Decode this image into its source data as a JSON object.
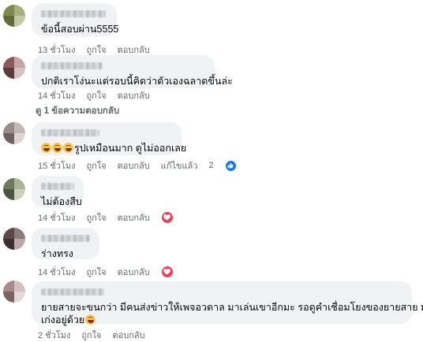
{
  "comments": [
    {
      "text": "ข้อนี้สอบผ่าน5555",
      "time": "13 ชั่วโมง",
      "like": "ถูกใจ",
      "reply": "ตอบกลับ",
      "avatar_colors": [
        "#7c8a4e",
        "#a7b07a",
        "#5f6b3a",
        "#c3c8a4"
      ]
    },
    {
      "text": "ปกติเราโง่นะแต่รอบนี้คิดว่าตัวเองฉลาดขึ้นล่ะ",
      "time": "14 ชั่วโมง",
      "like": "ถูกใจ",
      "reply": "ตอบกลับ",
      "view_replies": "ดู 1 ข้อความตอบกลับ",
      "avatar_colors": [
        "#8a5a5a",
        "#c9a2a2",
        "#5b3b3b",
        "#d9c0c0"
      ]
    },
    {
      "text": "รูปเหมือนมาก ดูไม่ออกเลย",
      "time": "15 ชั่วโมง",
      "like": "ถูกใจ",
      "reply": "ตอบกลับ",
      "edited": "แก้ไขแล้ว",
      "reaction_count": "2",
      "avatar_colors": [
        "#9a8c88",
        "#c2b8b5",
        "#6d625f",
        "#ddd6d3"
      ]
    },
    {
      "text": "ไม่ต้องสืบ",
      "time": "14 ชั่วโมง",
      "like": "ถูกใจ",
      "reply": "ตอบกลับ",
      "avatar_colors": [
        "#6f7a5c",
        "#aab596",
        "#4c5540",
        "#c9d0bb"
      ]
    },
    {
      "text": "ร่างทรง",
      "time": "14 ชั่วโมง",
      "like": "ถูกใจ",
      "reply": "ตอบกลับ",
      "avatar_colors": [
        "#5a4a4a",
        "#8d7a7a",
        "#3d3030",
        "#b8a8a8"
      ]
    },
    {
      "text_line1": "ยายสายจะขนกว่า มีคนส่งข่าวให้เพจอวตาล มาเล่นเขาอีกมะ รอดูคำเชื่อมโยงของยายสาย มโน",
      "text_line2": "เก่งอยู่ด้วย",
      "time": "2 ชั่วโมง",
      "like": "ถูกใจ",
      "reply": "ตอบกลับ",
      "avatar_colors": [
        "#a88a8a",
        "#d2c0c0",
        "#7d6262",
        "#e4dada"
      ]
    }
  ]
}
